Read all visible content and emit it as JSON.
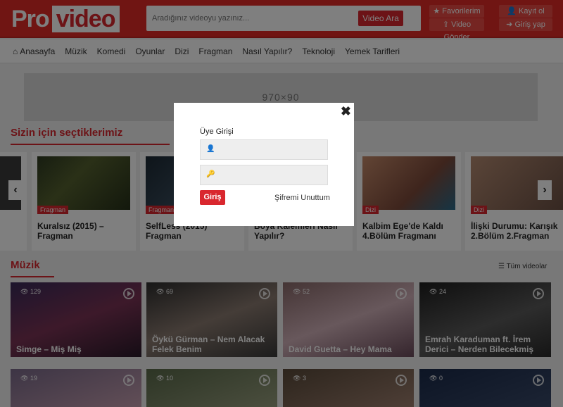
{
  "header": {
    "logo_pro": "Pro",
    "logo_video": "video",
    "search_placeholder": "Aradığınız videoyu yazınız...",
    "search_button": "Video Ara",
    "favorites": "Favorilerim",
    "submit_video": "Video Gönder",
    "register": "Kayıt ol",
    "login": "Giriş yap"
  },
  "nav": {
    "items": [
      "Anasayfa",
      "Müzik",
      "Komedi",
      "Oyunlar",
      "Dizi",
      "Fragman",
      "Nasıl Yapılır?",
      "Teknoloji",
      "Yemek Tarifleri"
    ]
  },
  "ad": {
    "label": "970×90"
  },
  "picks": {
    "title": "Sizin için seçtiklerimiz",
    "cards": [
      {
        "tag": "Fragman",
        "title": "Kuralsız (2015) – Fragman"
      },
      {
        "tag": "Fragman",
        "title": "SelfLess (2015) Fragman"
      },
      {
        "tag": "",
        "title": "Boya Kalemleri Nasıl Yapılır?"
      },
      {
        "tag": "Dizi",
        "title": "Kalbim Ege'de Kaldı 4.Bölüm Fragmanı"
      },
      {
        "tag": "Dizi",
        "title": "İlişki Durumu: Karışık 2.Bölüm 2.Fragman"
      }
    ]
  },
  "music": {
    "title": "Müzik",
    "all_videos": "Tüm videolar",
    "videos": [
      {
        "views": "129",
        "title": "Simge – Miş Miş",
        "color": "#5a2a4a"
      },
      {
        "views": "69",
        "title": "Öykü Gürman – Nem Alacak Felek Benim",
        "color": "#3a3a3a"
      },
      {
        "views": "52",
        "title": "David Guetta – Hey Mama",
        "color": "#6a5a60"
      },
      {
        "views": "24",
        "title": "Emrah Karaduman ft. İrem Derici – Nerden Bilecekmiş",
        "color": "#2e2e2e"
      }
    ],
    "row2_views": [
      "19",
      "10",
      "3",
      "0"
    ]
  },
  "modal": {
    "title": "Üye Girişi",
    "login_button": "Giriş",
    "forgot": "Şifremi Unuttum",
    "close": "✖"
  }
}
